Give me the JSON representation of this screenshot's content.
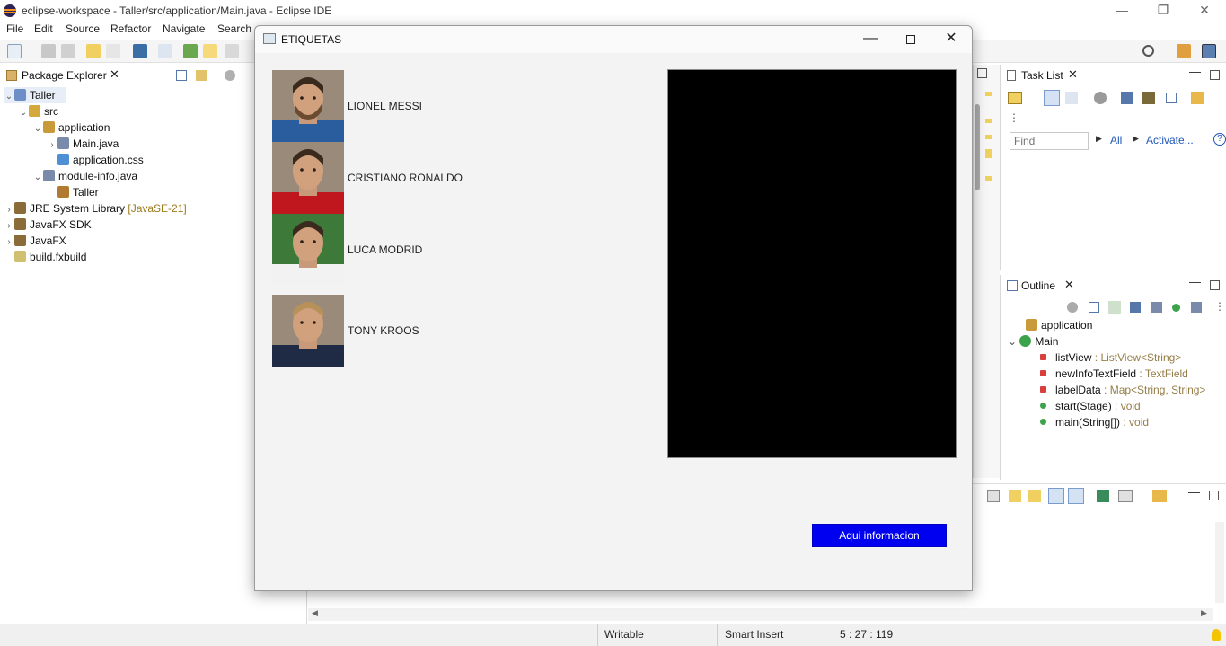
{
  "window": {
    "title": "eclipse-workspace - Taller/src/application/Main.java - Eclipse IDE",
    "minimize_glyph": "—",
    "restore_glyph": "❐",
    "close_glyph": "✕"
  },
  "menubar": [
    "File",
    "Edit",
    "Source",
    "Refactor",
    "Navigate",
    "Search"
  ],
  "package_explorer": {
    "title": "Package Explorer",
    "tree": [
      {
        "label": "Taller",
        "depth": 0,
        "chev": "v",
        "icon": "project-icon"
      },
      {
        "label": "src",
        "depth": 1,
        "chev": "v",
        "icon": "source-folder-icon"
      },
      {
        "label": "application",
        "depth": 2,
        "chev": "v",
        "icon": "package-icon"
      },
      {
        "label": "Main.java",
        "depth": 3,
        "chev": ">",
        "icon": "java-file-icon"
      },
      {
        "label": "application.css",
        "depth": 3,
        "chev": "",
        "icon": "css-file-icon"
      },
      {
        "label": "module-info.java",
        "depth": 2,
        "chev": "v",
        "icon": "java-file-icon"
      },
      {
        "label": "Taller",
        "depth": 3,
        "chev": "",
        "icon": "module-icon"
      },
      {
        "label": "JRE System Library",
        "suffix": "[JavaSE-21]",
        "depth": 0,
        "chev": ">",
        "icon": "library-icon"
      },
      {
        "label": "JavaFX SDK",
        "depth": 0,
        "chev": ">",
        "icon": "library-icon"
      },
      {
        "label": "JavaFX",
        "depth": 0,
        "chev": ">",
        "icon": "library-icon"
      },
      {
        "label": "build.fxbuild",
        "depth": 0,
        "chev": "",
        "icon": "build-file-icon"
      }
    ]
  },
  "task_list": {
    "title": "Task List",
    "find_placeholder": "Find",
    "all_label": "All",
    "activate_label": "Activate..."
  },
  "outline": {
    "title": "Outline",
    "items": [
      {
        "name": "application",
        "type": "",
        "depth": 0
      },
      {
        "name": "Main",
        "type": "",
        "depth": 0
      },
      {
        "name": "listView",
        "type": " : ListView<String>",
        "depth": 1
      },
      {
        "name": "newInfoTextField",
        "type": " : TextField",
        "depth": 1
      },
      {
        "name": "labelData",
        "type": " : Map<String, String>",
        "depth": 1
      },
      {
        "name": "start(Stage)",
        "type": " : void",
        "depth": 1
      },
      {
        "name": "main(String[])",
        "type": " : void",
        "depth": 1
      }
    ]
  },
  "statusbar": {
    "writable": "Writable",
    "insert_mode": "Smart Insert",
    "position": "5 : 27 : 119"
  },
  "dialog": {
    "title": "ETIQUETAS",
    "players": [
      {
        "name": "LIONEL MESSI",
        "jersey": "#2a5d9e"
      },
      {
        "name": "CRISTIANO RONALDO",
        "jersey": "#c0161e"
      },
      {
        "name": "LUCA MODRID",
        "jersey": "#f2f2f2"
      },
      {
        "name": "TONY KROOS",
        "jersey": "#1f2a44"
      }
    ],
    "button_label": "Aqui informacion",
    "accent": "#0000f0"
  }
}
